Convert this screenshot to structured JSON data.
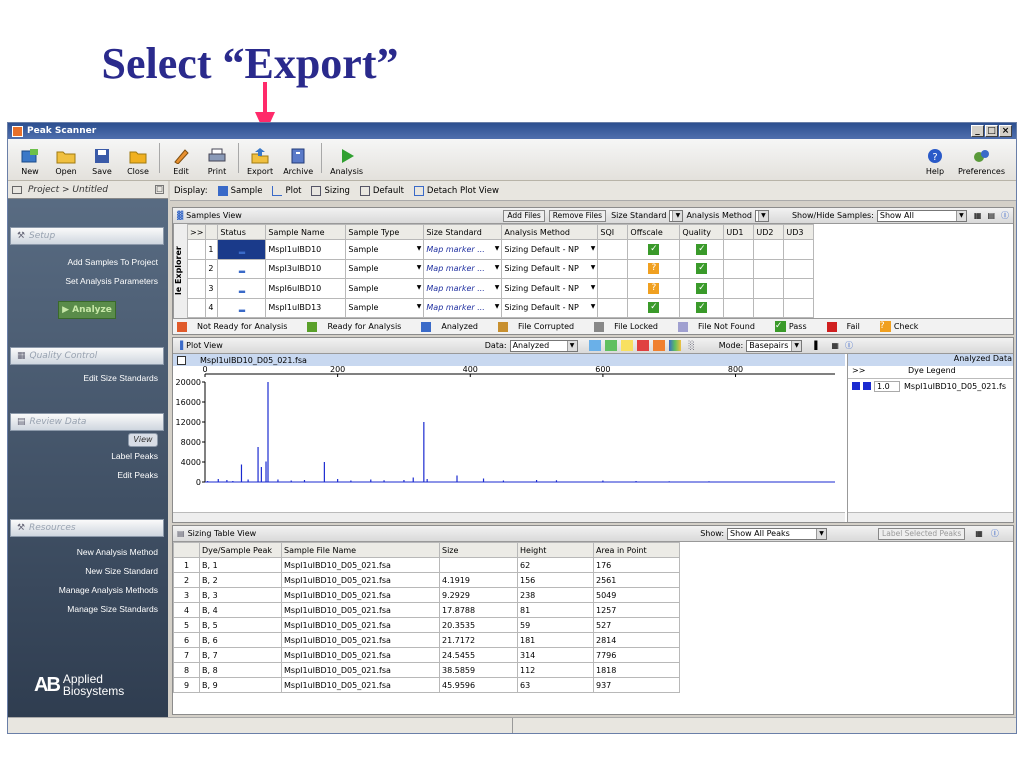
{
  "slide_title": "Select “Export”",
  "colors": {
    "title": "#2a2a8c",
    "arrow": "#ff2a6a",
    "accent": "#2d4f8f",
    "trace": "#1a2ad0"
  },
  "window": {
    "title": "Peak Scanner",
    "controls": [
      "_",
      "□",
      "×"
    ]
  },
  "toolbar": {
    "buttons": [
      {
        "label": "New",
        "icon": "new-icon"
      },
      {
        "label": "Open",
        "icon": "folder-icon"
      },
      {
        "label": "Save",
        "icon": "save-icon"
      },
      {
        "label": "Close",
        "icon": "close-folder-icon"
      },
      {
        "label": "Edit",
        "icon": "edit-icon"
      },
      {
        "label": "Print",
        "icon": "print-icon"
      },
      {
        "label": "Export",
        "icon": "export-icon"
      },
      {
        "label": "Archive",
        "icon": "archive-icon"
      },
      {
        "label": "Analysis",
        "icon": "play-icon"
      }
    ],
    "help_label": "Help",
    "preferences_label": "Preferences"
  },
  "sidebar": {
    "project_title": "Project > Untitled",
    "setup_head": "Setup",
    "setup_items": [
      "Add Samples To Project",
      "Set Analysis Parameters"
    ],
    "analyze_label": "Analyze",
    "quality_head": "Quality Control",
    "quality_items": [
      "Edit Size Standards"
    ],
    "review_head": "Review Data",
    "view_label": "View",
    "review_items": [
      "Label Peaks",
      "Edit Peaks"
    ],
    "resources_head": "Resources",
    "resources_items": [
      "New Analysis Method",
      "New Size Standard",
      "Manage Analysis Methods",
      "Manage Size Standards"
    ],
    "brand_ab": "AB",
    "brand_line1": "Applied",
    "brand_line2": "Biosystems"
  },
  "display_bar": {
    "label": "Display:",
    "items": [
      "Sample",
      "Plot",
      "Sizing",
      "Default",
      "Detach Plot View"
    ]
  },
  "samples_view": {
    "title": "Samples View",
    "add_files": "Add Files",
    "remove_files": "Remove Files",
    "size_standard_label": "Size Standard",
    "analysis_method_label": "Analysis Method",
    "show_hide_label": "Show/Hide Samples:",
    "show_hide_value": "Show All",
    "explorer_label": "le Explorer",
    "columns": [
      ">>",
      "",
      "Status",
      "Sample Name",
      "Sample Type",
      "Size Standard",
      "Analysis Method",
      "SQI",
      "Offscale",
      "Quality",
      "UD1",
      "UD2",
      "UD3"
    ],
    "rows": [
      {
        "num": "1",
        "name": "MspI1uIBD10",
        "type": "Sample",
        "size_std": "Map marker ...",
        "method": "Sizing Default - NP",
        "offscale": "pass",
        "quality": "pass"
      },
      {
        "num": "2",
        "name": "MspI3uIBD10",
        "type": "Sample",
        "size_std": "Map marker ...",
        "method": "Sizing Default - NP",
        "offscale": "check",
        "quality": "pass"
      },
      {
        "num": "3",
        "name": "MspI6uIBD10",
        "type": "Sample",
        "size_std": "Map marker ...",
        "method": "Sizing Default - NP",
        "offscale": "check",
        "quality": "pass"
      },
      {
        "num": "4",
        "name": "MspI1uIBD13",
        "type": "Sample",
        "size_std": "Map marker ...",
        "method": "Sizing Default - NP",
        "offscale": "pass",
        "quality": "pass"
      }
    ],
    "legend": [
      "Not Ready for Analysis",
      "Ready for Analysis",
      "Analyzed",
      "File Corrupted",
      "File Locked",
      "File Not Found",
      "Pass",
      "Fail",
      "Check"
    ]
  },
  "plot_view": {
    "title": "Plot View",
    "data_label": "Data:",
    "data_value": "Analyzed",
    "mode_label": "Mode:",
    "mode_value": "Basepairs",
    "sample_title": "MspI1uIBD10_D05_021.fsa",
    "analyzed_label": "Analyzed Data",
    "dye_legend_col1": ">>",
    "dye_legend_col2": "Dye Legend",
    "dye_value": "1.0",
    "dye_file": "MspI1uIBD10_D05_021.fs"
  },
  "chart_data": {
    "type": "line",
    "x_ticks": [
      0,
      200,
      400,
      600,
      800
    ],
    "y_ticks": [
      0,
      4000,
      8000,
      12000,
      16000,
      20000
    ],
    "xlim": [
      0,
      950
    ],
    "ylim": [
      0,
      20000
    ],
    "peaks": [
      {
        "x": 4,
        "y": 200
      },
      {
        "x": 20,
        "y": 600
      },
      {
        "x": 33,
        "y": 400
      },
      {
        "x": 42,
        "y": 200
      },
      {
        "x": 55,
        "y": 3500
      },
      {
        "x": 65,
        "y": 500
      },
      {
        "x": 80,
        "y": 7000
      },
      {
        "x": 85,
        "y": 3000
      },
      {
        "x": 92,
        "y": 4100
      },
      {
        "x": 95,
        "y": 20000
      },
      {
        "x": 110,
        "y": 500
      },
      {
        "x": 130,
        "y": 300
      },
      {
        "x": 150,
        "y": 400
      },
      {
        "x": 180,
        "y": 4000
      },
      {
        "x": 200,
        "y": 600
      },
      {
        "x": 220,
        "y": 300
      },
      {
        "x": 250,
        "y": 500
      },
      {
        "x": 270,
        "y": 350
      },
      {
        "x": 300,
        "y": 400
      },
      {
        "x": 314,
        "y": 900
      },
      {
        "x": 330,
        "y": 12000
      },
      {
        "x": 335,
        "y": 600
      },
      {
        "x": 380,
        "y": 1300
      },
      {
        "x": 420,
        "y": 700
      },
      {
        "x": 450,
        "y": 300
      },
      {
        "x": 500,
        "y": 400
      },
      {
        "x": 530,
        "y": 350
      },
      {
        "x": 600,
        "y": 300
      },
      {
        "x": 650,
        "y": 200
      },
      {
        "x": 700,
        "y": 150
      },
      {
        "x": 760,
        "y": 150
      },
      {
        "x": 850,
        "y": 100
      }
    ]
  },
  "sizing_table": {
    "title": "Sizing Table View",
    "show_label": "Show:",
    "show_value": "Show All Peaks",
    "label_selected": "Label Selected Peaks",
    "columns": [
      "",
      "Dye/Sample Peak",
      "Sample File Name",
      "Size",
      "Height",
      "Area in Point"
    ],
    "rows": [
      [
        "1",
        "B, 1",
        "MspI1uIBD10_D05_021.fsa",
        "",
        "62",
        "176"
      ],
      [
        "2",
        "B, 2",
        "MspI1uIBD10_D05_021.fsa",
        "4.1919",
        "156",
        "2561"
      ],
      [
        "3",
        "B, 3",
        "MspI1uIBD10_D05_021.fsa",
        "9.2929",
        "238",
        "5049"
      ],
      [
        "4",
        "B, 4",
        "MspI1uIBD10_D05_021.fsa",
        "17.8788",
        "81",
        "1257"
      ],
      [
        "5",
        "B, 5",
        "MspI1uIBD10_D05_021.fsa",
        "20.3535",
        "59",
        "527"
      ],
      [
        "6",
        "B, 6",
        "MspI1uIBD10_D05_021.fsa",
        "21.7172",
        "181",
        "2814"
      ],
      [
        "7",
        "B, 7",
        "MspI1uIBD10_D05_021.fsa",
        "24.5455",
        "314",
        "7796"
      ],
      [
        "8",
        "B, 8",
        "MspI1uIBD10_D05_021.fsa",
        "38.5859",
        "112",
        "1818"
      ],
      [
        "9",
        "B, 9",
        "MspI1uIBD10_D05_021.fsa",
        "45.9596",
        "63",
        "937"
      ]
    ]
  }
}
